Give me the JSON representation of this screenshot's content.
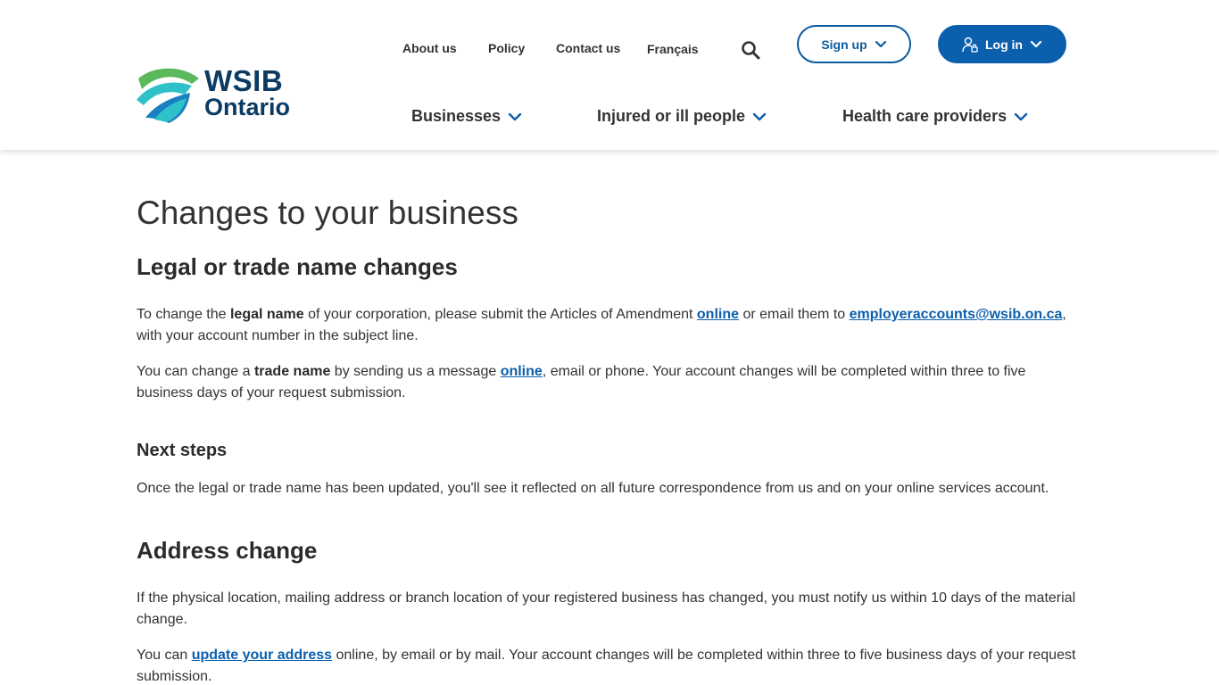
{
  "logo": {
    "line1": "WSIB",
    "line2": "Ontario"
  },
  "utility_nav": [
    {
      "label": "About us"
    },
    {
      "label": "Policy"
    },
    {
      "label": "Contact us"
    },
    {
      "label": "Français"
    }
  ],
  "account": {
    "signup_label": "Sign up",
    "login_label": "Log in"
  },
  "main_nav": [
    {
      "label": "Businesses"
    },
    {
      "label": "Injured or ill people"
    },
    {
      "label": "Health care providers"
    }
  ],
  "colors": {
    "brand_blue": "#0b5fad",
    "logo_navy": "#0b3b63",
    "logo_green": "#5cb85c",
    "logo_teal": "#2fc1c9"
  },
  "page": {
    "title": "Changes to your business",
    "section1": {
      "heading": "Legal or trade name changes",
      "p1": {
        "t1": "To change the ",
        "b1": "legal name",
        "t2": " of your corporation, please submit the Articles of Amendment ",
        "link1": "online",
        "t3": " or email them to ",
        "link2": "employeraccounts@wsib.on.ca",
        "t4": ", with your account number in the subject line."
      },
      "p2": {
        "t1": "You can change a ",
        "b1": "trade name",
        "t2": " by sending us a message ",
        "link1": "online",
        "t3": ", email or phone. Your account changes will be completed within three to five business days of your request submission."
      },
      "next_steps_heading": "Next steps",
      "p3": "Once the legal or trade name has been updated, you'll see it reflected on all future correspondence from us and on your online services account."
    },
    "section2": {
      "heading": "Address change",
      "p1": "If the physical location, mailing address or branch location of your registered business has changed, you must notify us within 10 days of the material change.",
      "p2": {
        "t1": "You can ",
        "link1": "update your address",
        "t2": " online, by email or by mail. Your account changes will be completed within three to five business days of your request submission."
      }
    }
  }
}
